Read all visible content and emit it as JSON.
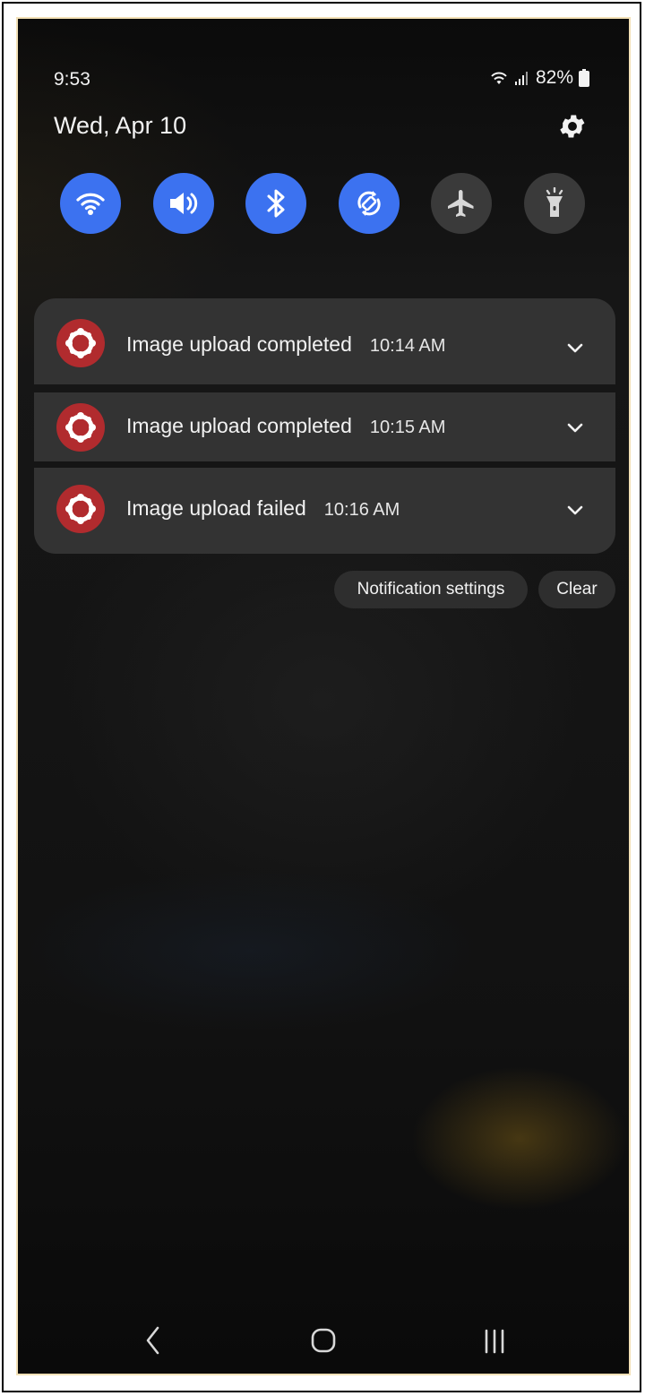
{
  "status_bar": {
    "time": "9:53",
    "battery": "82%",
    "wifi_icon": "wifi-icon",
    "signal_icon": "signal-icon",
    "battery_icon": "battery-icon"
  },
  "header": {
    "date": "Wed, Apr 10",
    "settings_icon": "gear-icon"
  },
  "quick_settings": [
    {
      "name": "wifi",
      "icon": "wifi-icon",
      "active": true
    },
    {
      "name": "sound",
      "icon": "volume-icon",
      "active": true
    },
    {
      "name": "bluetooth",
      "icon": "bluetooth-icon",
      "active": true
    },
    {
      "name": "auto-rotate",
      "icon": "rotate-icon",
      "active": true
    },
    {
      "name": "airplane-mode",
      "icon": "airplane-icon",
      "active": false
    },
    {
      "name": "flashlight",
      "icon": "flashlight-icon",
      "active": false
    }
  ],
  "notifications": [
    {
      "title": "Image upload completed",
      "time": "10:14 AM",
      "icon": "app-icon"
    },
    {
      "title": "Image upload completed",
      "time": "10:15 AM",
      "icon": "app-icon"
    },
    {
      "title": "Image upload failed",
      "time": "10:16 AM",
      "icon": "app-icon"
    }
  ],
  "actions": {
    "notification_settings": "Notification settings",
    "clear": "Clear"
  },
  "nav_bar": {
    "back_icon": "back-icon",
    "home_icon": "home-icon",
    "recents_icon": "recents-icon"
  },
  "colors": {
    "toggle_on": "#3c72f0",
    "toggle_off": "#3a3a3a",
    "notification_bg": "#333333",
    "app_icon": "#b12b2e"
  }
}
